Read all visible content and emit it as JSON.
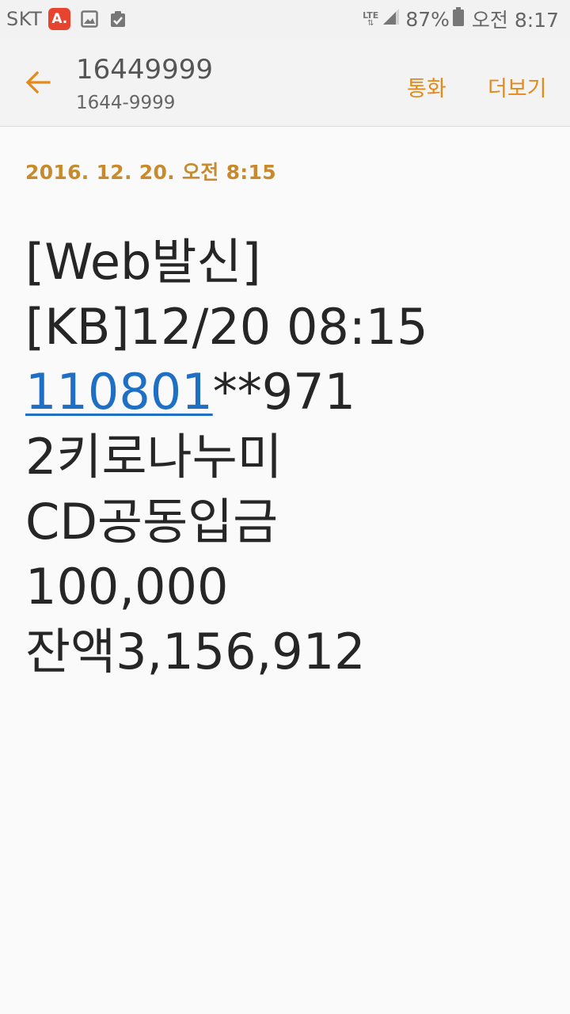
{
  "status_bar": {
    "carrier": "SKT",
    "notif_icon_letter": "A.",
    "icons": [
      "app-a-icon",
      "image-icon",
      "clipboard-check-icon"
    ],
    "network": "LTE",
    "battery_pct": "87%",
    "time": "오전 8:17"
  },
  "header": {
    "contact_name": "16449999",
    "contact_number": "1644-9999",
    "call_label": "통화",
    "more_label": "더보기",
    "accent_color": "#e48a1b"
  },
  "message": {
    "date": "2016. 12. 20.  오전 8:15",
    "lines": {
      "l1": "[Web발신]",
      "l2": "[KB]12/20 08:15",
      "l3_link": "110801",
      "l3_rest": "**971",
      "l4": "2키로나누미",
      "l5": "CD공동입금",
      "l6": "100,000",
      "l7": "잔액3,156,912"
    },
    "link_color": "#1f6fc5"
  }
}
